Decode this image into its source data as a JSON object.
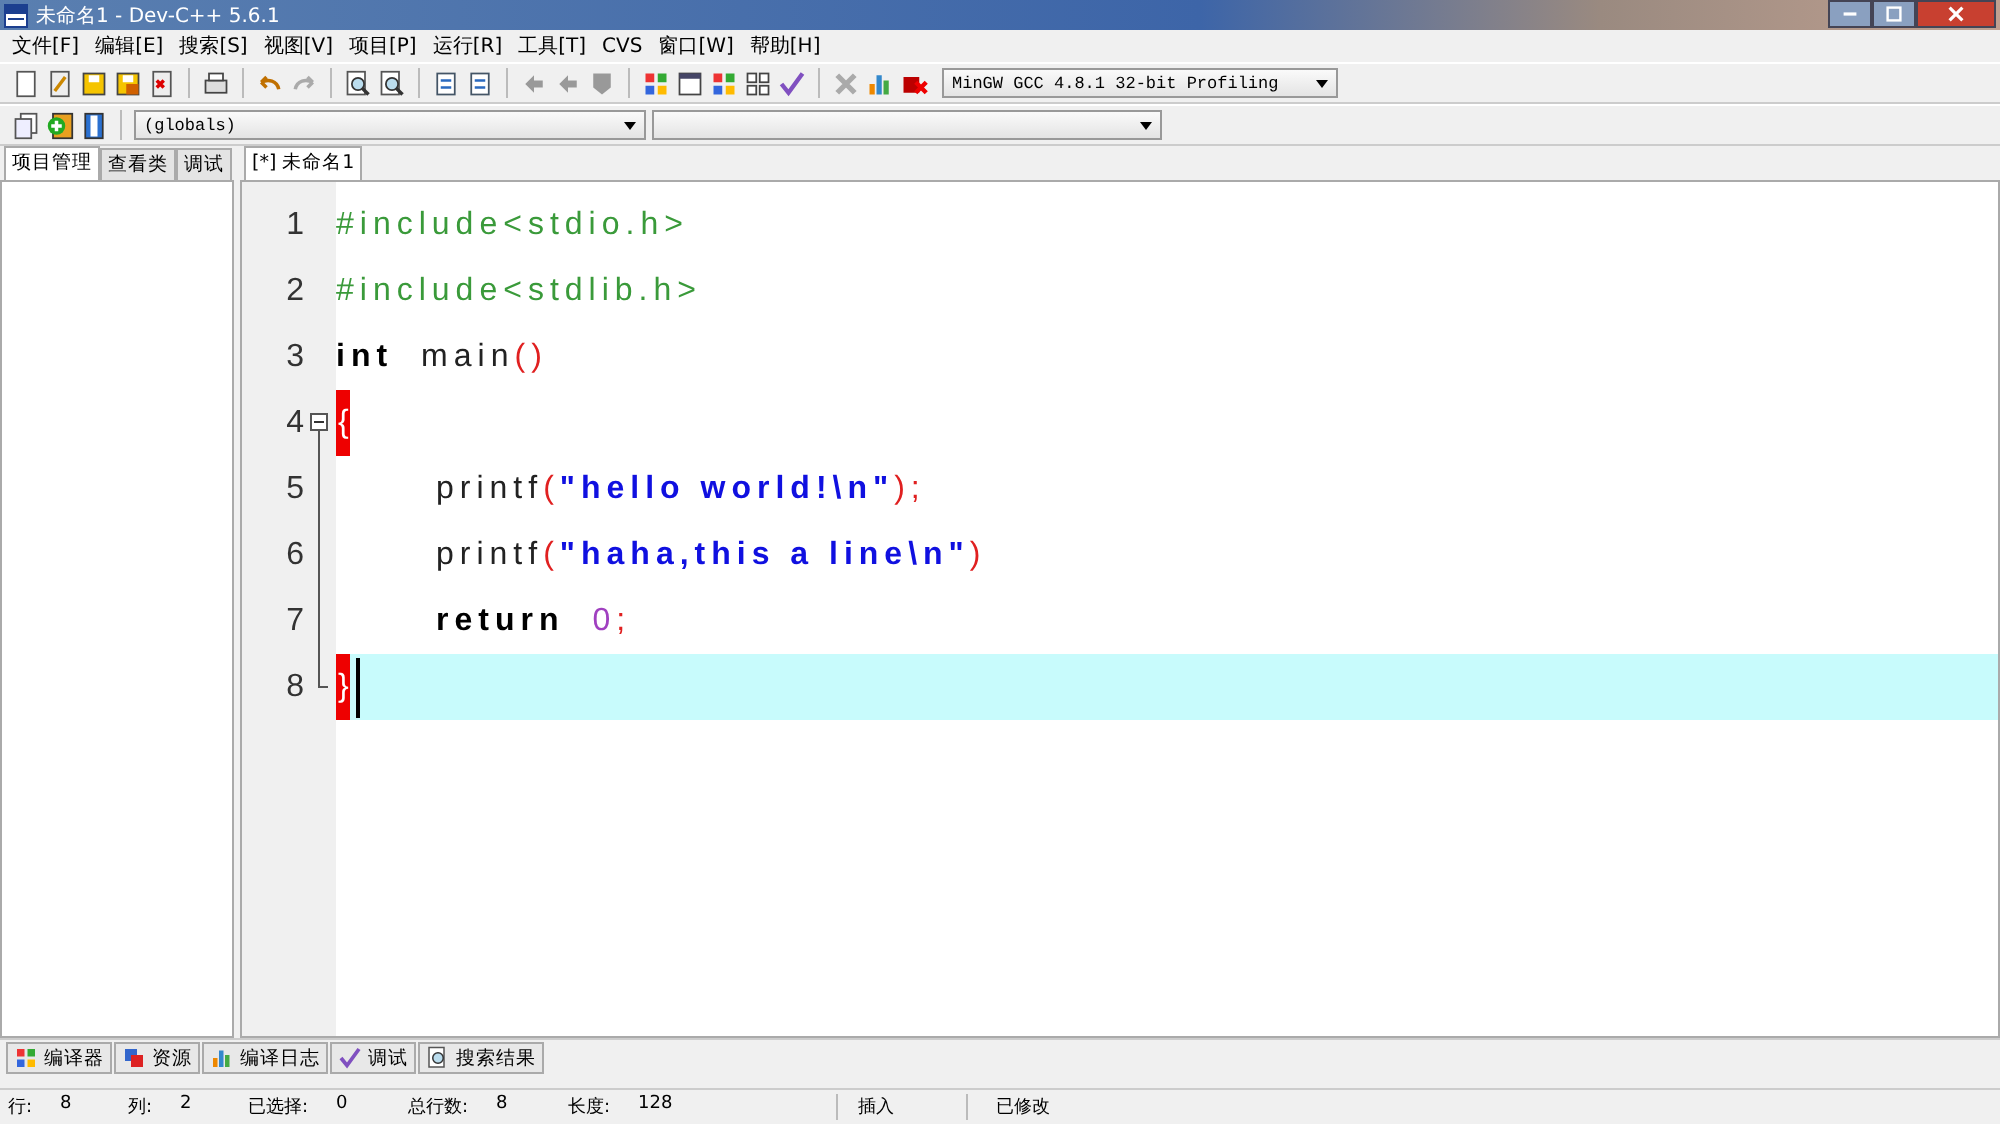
{
  "window": {
    "title": "未命名1 - Dev-C++ 5.6.1"
  },
  "menu": [
    "文件[F]",
    "编辑[E]",
    "搜索[S]",
    "视图[V]",
    "项目[P]",
    "运行[R]",
    "工具[T]",
    "CVS",
    "窗口[W]",
    "帮助[H]"
  ],
  "compiler_select": {
    "value": "MinGW GCC 4.8.1 32-bit Profiling"
  },
  "scope_select": {
    "value": "(globals)"
  },
  "left_tabs": [
    {
      "label": "项目管理",
      "selected": true
    },
    {
      "label": "查看类",
      "selected": false
    },
    {
      "label": "调试",
      "selected": false
    }
  ],
  "editor_tabs": [
    {
      "label": "[*] 未命名1",
      "selected": true
    }
  ],
  "code_lines": [
    {
      "number": "1",
      "indented": false,
      "current": false,
      "fold_start": false,
      "fold_body": false,
      "fold_end": false,
      "tokens": [
        {
          "kind": "preproc",
          "text": "#include<stdio.h>"
        }
      ]
    },
    {
      "number": "2",
      "indented": false,
      "current": false,
      "fold_start": false,
      "fold_body": false,
      "fold_end": false,
      "tokens": [
        {
          "kind": "preproc",
          "text": "#include<stdlib.h>"
        }
      ]
    },
    {
      "number": "3",
      "indented": false,
      "current": false,
      "fold_start": false,
      "fold_body": false,
      "fold_end": false,
      "tokens": [
        {
          "kind": "keyword",
          "text": "int"
        },
        {
          "kind": "ident",
          "text": "main"
        },
        {
          "kind": "punct",
          "text": "()"
        }
      ]
    },
    {
      "number": "4",
      "indented": false,
      "current": false,
      "fold_start": true,
      "fold_body": false,
      "fold_end": false,
      "tokens": [
        {
          "kind": "brace",
          "text": "{"
        }
      ]
    },
    {
      "number": "5",
      "indented": true,
      "current": false,
      "fold_start": false,
      "fold_body": true,
      "fold_end": false,
      "tokens": [
        {
          "kind": "ident",
          "text": "printf"
        },
        {
          "kind": "punct",
          "text": "("
        },
        {
          "kind": "string",
          "text": "\"hello world!\\n\""
        },
        {
          "kind": "punct",
          "text": ");"
        }
      ]
    },
    {
      "number": "6",
      "indented": true,
      "current": false,
      "fold_start": false,
      "fold_body": true,
      "fold_end": false,
      "tokens": [
        {
          "kind": "ident",
          "text": "printf"
        },
        {
          "kind": "punct",
          "text": "("
        },
        {
          "kind": "string",
          "text": "\"haha,this a line\\n\""
        },
        {
          "kind": "punct",
          "text": ")"
        }
      ]
    },
    {
      "number": "7",
      "indented": true,
      "current": false,
      "fold_start": false,
      "fold_body": true,
      "fold_end": false,
      "tokens": [
        {
          "kind": "keyword",
          "text": "return"
        },
        {
          "kind": "number",
          "text": "0"
        },
        {
          "kind": "punct",
          "text": ";"
        }
      ]
    },
    {
      "number": "8",
      "indented": false,
      "current": true,
      "fold_start": false,
      "fold_body": false,
      "fold_end": true,
      "tokens": [
        {
          "kind": "brace",
          "text": "}"
        }
      ]
    }
  ],
  "bottom_tabs": [
    {
      "label": "编译器"
    },
    {
      "label": "资源"
    },
    {
      "label": "编译日志"
    },
    {
      "label": "调试"
    },
    {
      "label": "搜索结果"
    }
  ],
  "status_bar": [
    {
      "label": "行:",
      "value": "8"
    },
    {
      "label": "列:",
      "value": "2"
    },
    {
      "label": "已选择:",
      "value": "0"
    },
    {
      "label": "总行数:",
      "value": "8"
    },
    {
      "label": "长度:",
      "value": "128"
    },
    {
      "label": "插入"
    },
    {
      "label": "已修改"
    }
  ]
}
